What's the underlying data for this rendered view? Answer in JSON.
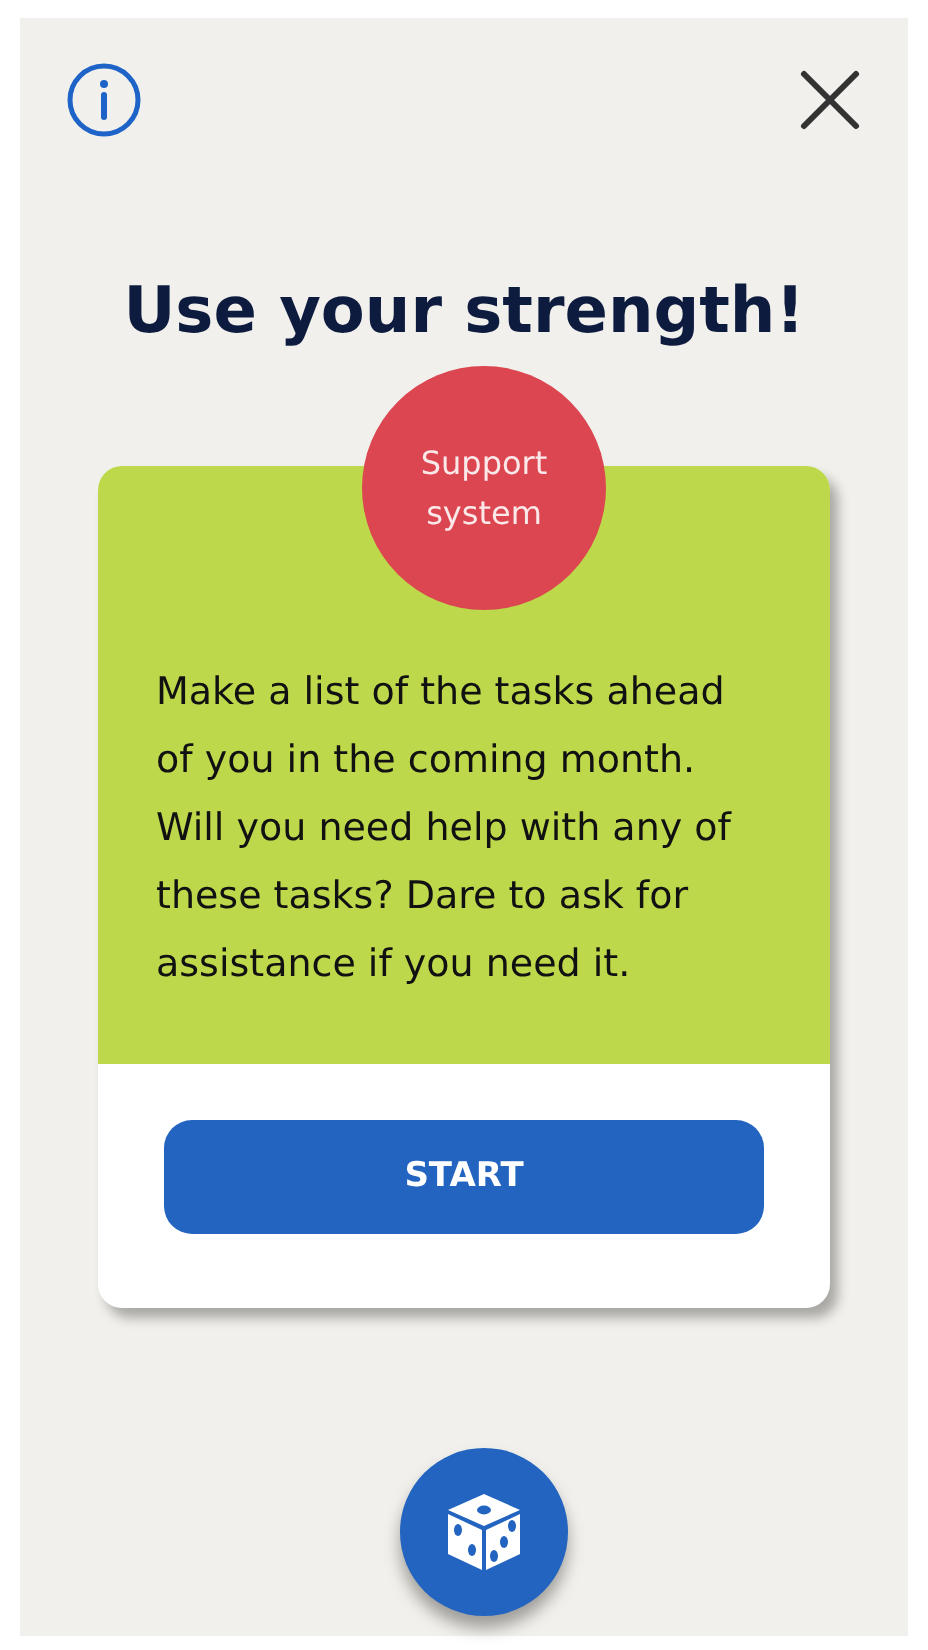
{
  "title": "Use your strength!",
  "card": {
    "badge": "Support system",
    "text": "Make a list of the tasks ahead of you in the coming month. Will you need help with any of these tasks? Dare to ask for assistance if you need it.",
    "button": "START"
  }
}
